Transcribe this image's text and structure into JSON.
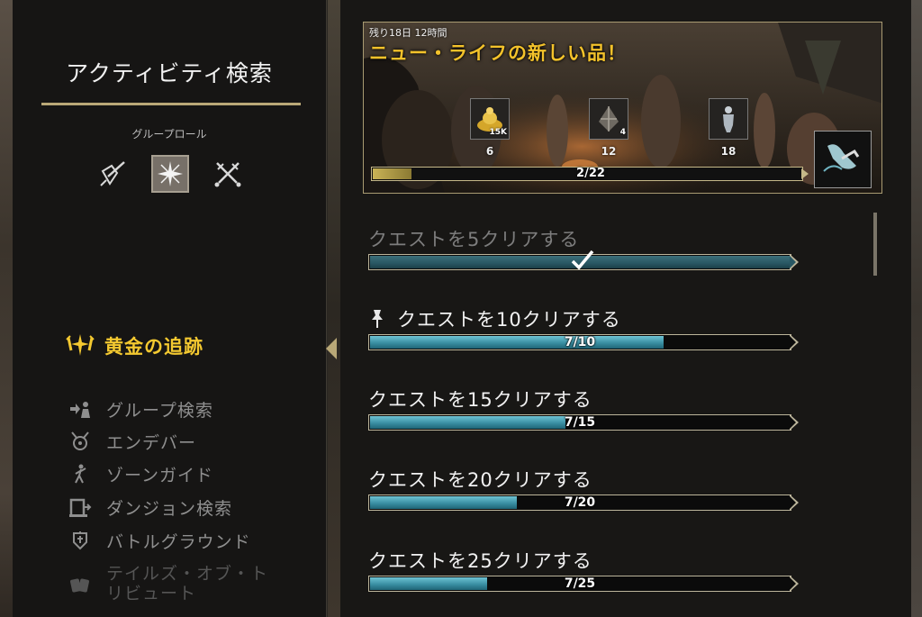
{
  "sidebar": {
    "title": "アクティビティ検索",
    "role_label": "グループロール",
    "roles": [
      {
        "icon": "tank-shield-sword-icon",
        "selected": false
      },
      {
        "icon": "healer-icon",
        "selected": true
      },
      {
        "icon": "damage-crossed-swords-icon",
        "selected": false
      }
    ],
    "active_activity": {
      "label": "黄金の追跡",
      "icon": "golden-pursuits-icon"
    },
    "activities": [
      {
        "label": "グループ検索",
        "icon": "group-finder-icon"
      },
      {
        "label": "エンデバー",
        "icon": "endeavor-icon"
      },
      {
        "label": "ゾーンガイド",
        "icon": "zone-guide-icon"
      },
      {
        "label": "ダンジョン検索",
        "icon": "dungeon-finder-icon"
      },
      {
        "label": "バトルグラウンド",
        "icon": "battleground-icon"
      },
      {
        "label": "テイルズ・オブ・トリビュート",
        "icon": "tales-of-tribute-icon"
      }
    ]
  },
  "banner": {
    "time_left": "残り18日 12時間",
    "title": "ニュー・ライフの新しい品！",
    "rewards": [
      {
        "icon": "gold-pile-icon",
        "qty": "15K",
        "count": "6"
      },
      {
        "icon": "crown-crate-shard-icon",
        "qty": "4",
        "count": "12"
      },
      {
        "icon": "costume-figure-icon",
        "qty": "",
        "count": "18"
      }
    ],
    "final_reward_icon": "mount-leap-icon",
    "progress": {
      "current": 2,
      "total": 22,
      "text": "2/22"
    }
  },
  "quests": [
    {
      "name": "クエストを5クリアする",
      "progress_text": "",
      "fraction": 1.0,
      "done": true,
      "pinned": false
    },
    {
      "name": "クエストを10クリアする",
      "progress_text": "7/10",
      "fraction": 0.7,
      "done": false,
      "pinned": true
    },
    {
      "name": "クエストを15クリアする",
      "progress_text": "7/15",
      "fraction": 0.4667,
      "done": false,
      "pinned": false
    },
    {
      "name": "クエストを20クリアする",
      "progress_text": "7/20",
      "fraction": 0.35,
      "done": false,
      "pinned": false
    },
    {
      "name": "クエストを25クリアする",
      "progress_text": "7/25",
      "fraction": 0.28,
      "done": false,
      "pinned": false
    }
  ],
  "colors": {
    "accent_gold": "#f4c930",
    "bar_teal": "#3a8fa3",
    "frame": "#b9a877"
  }
}
